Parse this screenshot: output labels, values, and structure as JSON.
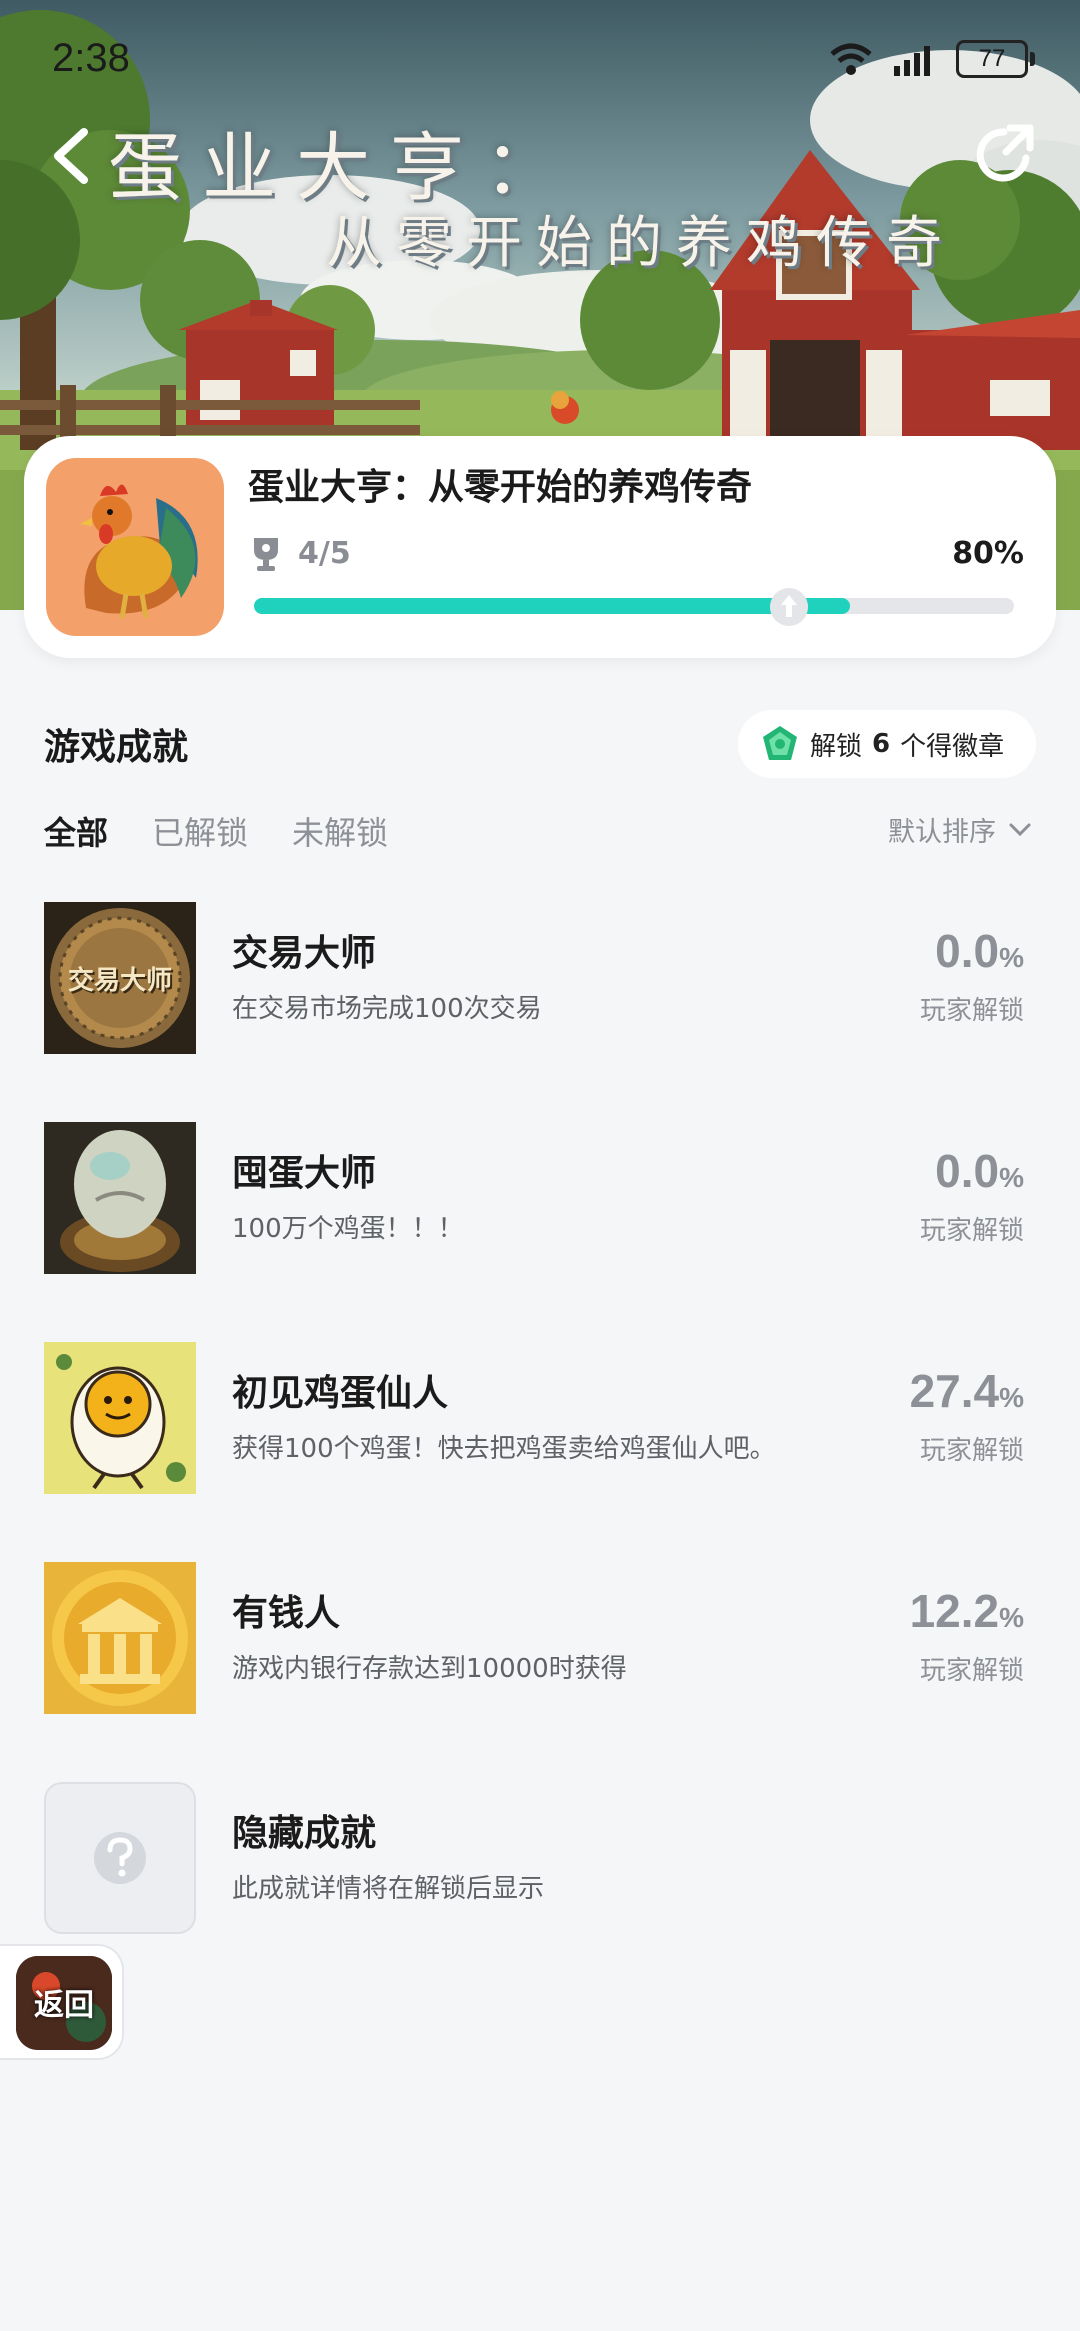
{
  "status_bar": {
    "time": "2:38",
    "battery": "77"
  },
  "hero": {
    "title_line1": "蛋业大亨：",
    "title_line2": "从零开始的养鸡传奇"
  },
  "game": {
    "name": "蛋业大亨：从零开始的养鸡传奇",
    "trophies": "4/5",
    "percent_label": "80%",
    "progress": 0.8
  },
  "section": {
    "title": "游戏成就"
  },
  "badge_pill": {
    "prefix": "解锁",
    "count": "6",
    "suffix": "个得徽章"
  },
  "tabs": [
    {
      "label": "全部"
    },
    {
      "label": "已解锁"
    },
    {
      "label": "未解锁"
    }
  ],
  "sort": {
    "label": "默认排序"
  },
  "achievements": [
    {
      "title": "交易大师",
      "desc": "在交易市场完成100次交易",
      "rate": "0.0",
      "unit": "%",
      "rate_label": "玩家解锁",
      "thumb_text": "交易大师"
    },
    {
      "title": "囤蛋大师",
      "desc": "100万个鸡蛋！！！",
      "rate": "0.0",
      "unit": "%",
      "rate_label": "玩家解锁"
    },
    {
      "title": "初见鸡蛋仙人",
      "desc": "获得100个鸡蛋！快去把鸡蛋卖给鸡蛋仙人吧。",
      "rate": "27.4",
      "unit": "%",
      "rate_label": "玩家解锁"
    },
    {
      "title": "有钱人",
      "desc": "游戏内银行存款达到10000时获得",
      "rate": "12.2",
      "unit": "%",
      "rate_label": "玩家解锁"
    },
    {
      "title": "隐藏成就",
      "desc": "此成就详情将在解锁后显示"
    }
  ],
  "float_back": {
    "label": "返回"
  },
  "colors": {
    "accent": "#1ed2be",
    "background": "#f5f6f8"
  }
}
